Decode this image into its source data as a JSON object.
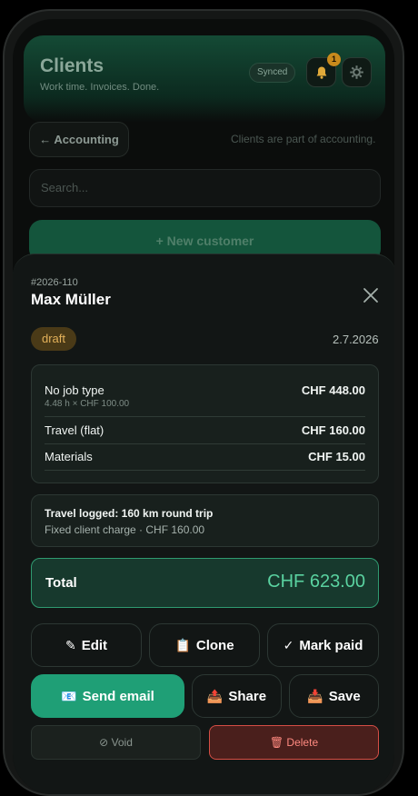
{
  "background": {
    "title": "Clients",
    "subtitle": "Work time. Invoices. Done.",
    "synced_label": "Synced",
    "notification_count": "1",
    "accounting_button": "← Accounting",
    "accounting_note": "Clients are part of accounting.",
    "search_placeholder": "Search...",
    "new_customer_button": "+ New customer"
  },
  "invoice": {
    "number": "#2026-110",
    "client": "Max Müller",
    "status": "draft",
    "date": "2.7.2026",
    "lines": [
      {
        "label": "No job type",
        "detail": "4.48 h × CHF 100.00",
        "amount": "CHF 448.00"
      },
      {
        "label": "Travel (flat)",
        "detail": "",
        "amount": "CHF 160.00"
      },
      {
        "label": "Materials",
        "detail": "",
        "amount": "CHF 15.00"
      }
    ],
    "travel_title": "Travel logged: 160 km round trip",
    "travel_sub": "Fixed client charge · CHF 160.00",
    "total_label": "Total",
    "total_amount": "CHF 623.00"
  },
  "actions": {
    "edit": {
      "icon": "✎",
      "label": "Edit"
    },
    "clone": {
      "icon": "📋",
      "label": "Clone"
    },
    "mark_paid": {
      "icon": "✓",
      "label": "Mark paid"
    },
    "send_email": {
      "icon": "📧",
      "label": "Send email"
    },
    "share": {
      "icon": "📤",
      "label": "Share"
    },
    "save": {
      "icon": "📥",
      "label": "Save"
    },
    "void": "⊘ Void",
    "delete": "🗑 Delete"
  },
  "colors": {
    "accent": "#1f9f76",
    "total_text": "#5ad2a0",
    "draft_badge": "#4a3a17",
    "danger": "#d54e45"
  }
}
